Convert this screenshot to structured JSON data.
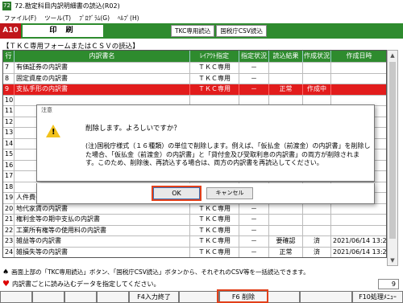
{
  "window": {
    "title": "72.勘定科目内訳明細書の読込(R02)",
    "icon": "app-icon"
  },
  "menu": [
    "ファイル(F)",
    "ツール(T)",
    "ﾌﾟﾛｸﾞﾗﾑ(G)",
    "ﾍﾙﾌﾟ(H)"
  ],
  "toolbar": {
    "mode": "A10",
    "print": "印 刷",
    "tkc_read": "TKC専用読込",
    "csv_read": "国税庁CSV読込"
  },
  "section_title": "【ＴＫＣ専用フォームまたはＣＳＶの読込】",
  "grid": {
    "columns": [
      "行",
      "内訳書名",
      "ﾚｲｱｳﾄ指定",
      "指定状況",
      "読込結果",
      "作成状況",
      "作成日時"
    ],
    "rows": [
      {
        "no": "7",
        "name": "有価証券の内訳書",
        "layout": "ＴＫＣ専用",
        "spec": "－",
        "result": "",
        "status": "",
        "date": ""
      },
      {
        "no": "8",
        "name": "固定資産の内訳書",
        "layout": "ＴＫＣ専用",
        "spec": "－",
        "result": "",
        "status": "",
        "date": ""
      },
      {
        "no": "9",
        "name": "支払手形の内訳書",
        "layout": "ＴＫＣ専用",
        "spec": "－",
        "result": "正常",
        "status": "作成中",
        "date": ""
      },
      {
        "no": "10",
        "name": "",
        "layout": "",
        "spec": "",
        "result": "",
        "status": "",
        "date": ""
      },
      {
        "no": "11",
        "name": "",
        "layout": "",
        "spec": "",
        "result": "",
        "status": "",
        "date": ""
      },
      {
        "no": "12",
        "name": "",
        "layout": "",
        "spec": "",
        "result": "",
        "status": "",
        "date": "3:13"
      },
      {
        "no": "13",
        "name": "",
        "layout": "",
        "spec": "",
        "result": "",
        "status": "",
        "date": "3:13"
      },
      {
        "no": "14",
        "name": "",
        "layout": "",
        "spec": "",
        "result": "",
        "status": "",
        "date": ""
      },
      {
        "no": "15",
        "name": "",
        "layout": "",
        "spec": "",
        "result": "",
        "status": "",
        "date": ""
      },
      {
        "no": "16",
        "name": "",
        "layout": "",
        "spec": "",
        "result": "",
        "status": "",
        "date": "3:08"
      },
      {
        "no": "17",
        "name": "",
        "layout": "",
        "spec": "",
        "result": "",
        "status": "",
        "date": "3:08"
      },
      {
        "no": "18",
        "name": "",
        "layout": "",
        "spec": "",
        "result": "",
        "status": "",
        "date": ""
      },
      {
        "no": "19",
        "name": "人件費の内訳",
        "layout": "ＴＫＣ専用",
        "spec": "－",
        "result": "",
        "status": "",
        "date": ""
      },
      {
        "no": "20",
        "name": "地代家賃の内訳書",
        "layout": "ＴＫＣ専用",
        "spec": "－",
        "result": "",
        "status": "",
        "date": ""
      },
      {
        "no": "21",
        "name": "権利金等の期中支払の内訳書",
        "layout": "ＴＫＣ専用",
        "spec": "－",
        "result": "",
        "status": "",
        "date": ""
      },
      {
        "no": "22",
        "name": "工業所有権等の使用料の内訳書",
        "layout": "ＴＫＣ専用",
        "spec": "－",
        "result": "",
        "status": "",
        "date": ""
      },
      {
        "no": "23",
        "name": "雑益等の内訳書",
        "layout": "ＴＫＣ専用",
        "spec": "－",
        "result": "要確認",
        "status": "済",
        "date": "2021/06/14 13:29"
      },
      {
        "no": "24",
        "name": "雑損失等の内訳書",
        "layout": "ＴＫＣ専用",
        "spec": "－",
        "result": "正常",
        "status": "済",
        "date": "2021/06/14 13:29"
      }
    ]
  },
  "bottom_note": "画面上部の「TKC専用読込」ボタン、「国税庁CSV読込」ボタンから、それぞれのCSV等を一括読込できます。",
  "hint": "内訳書ごとに読み込むデータを指定してください。",
  "counter": "9",
  "fkeys": {
    "f4": "F4入力終了",
    "f6": "F6 削除",
    "f10": "F10処理ﾒﾆｭｰ"
  },
  "dialog": {
    "title": "注意",
    "message": "削除します。よろしいですか？",
    "note": "(注)国税庁様式（１６種類）の単位で削除します。例えば、「仮払金（前渡金）の内訳書」を削除した場合、「仮払金（前渡金）の内訳書」と「貸付金及び受取利息の内訳書」の両方が削除されます。このため、削除後、再読込する場合は、両方の内訳書を再読込してください。",
    "ok": "OK",
    "cancel": "キャンセル"
  },
  "colors": {
    "header_green": "#2e8b2e",
    "selected_red": "#e21c1c",
    "highlight_orange": "#e2401a"
  }
}
